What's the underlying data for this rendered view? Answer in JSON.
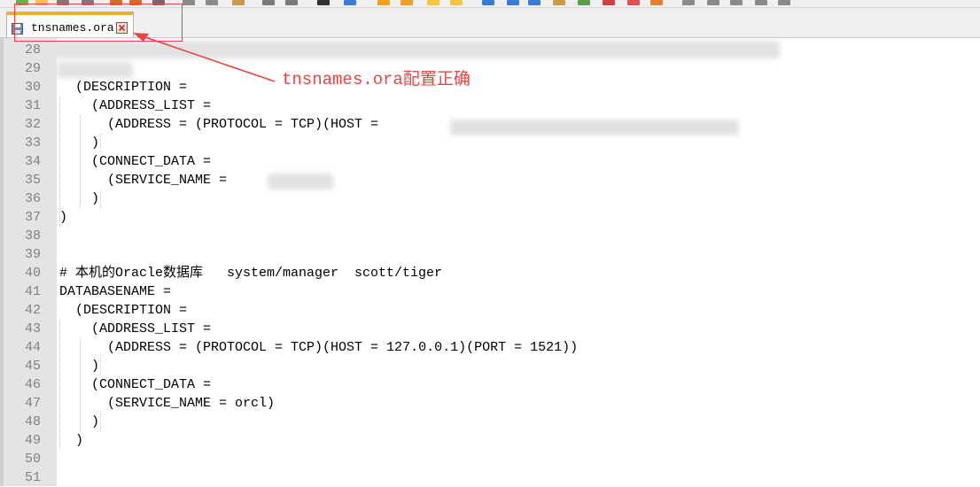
{
  "tab": {
    "title": "tnsnames.ora",
    "close_icon": "close-icon",
    "file_icon": "save-file-icon"
  },
  "annotation": {
    "text": "tnsnames.ora配置正确",
    "color": "#e84545"
  },
  "lines": [
    {
      "num": "28",
      "text": ""
    },
    {
      "num": "29",
      "text": ""
    },
    {
      "num": "30",
      "text": "  (DESCRIPTION ="
    },
    {
      "num": "31",
      "text": "    (ADDRESS_LIST ="
    },
    {
      "num": "32",
      "text": "      (ADDRESS = (PROTOCOL = TCP)(HOST ="
    },
    {
      "num": "33",
      "text": "    )"
    },
    {
      "num": "34",
      "text": "    (CONNECT_DATA ="
    },
    {
      "num": "35",
      "text": "      (SERVICE_NAME ="
    },
    {
      "num": "36",
      "text": "    )"
    },
    {
      "num": "37",
      "text": ")"
    },
    {
      "num": "38",
      "text": ""
    },
    {
      "num": "39",
      "text": ""
    },
    {
      "num": "40",
      "text": "# 本机的Oracle数据库   system/manager  scott/tiger"
    },
    {
      "num": "41",
      "text": "DATABASENAME ="
    },
    {
      "num": "42",
      "text": "  (DESCRIPTION ="
    },
    {
      "num": "43",
      "text": "    (ADDRESS_LIST ="
    },
    {
      "num": "44",
      "text": "      (ADDRESS = (PROTOCOL = TCP)(HOST = 127.0.0.1)(PORT = 1521))"
    },
    {
      "num": "45",
      "text": "    )"
    },
    {
      "num": "46",
      "text": "    (CONNECT_DATA ="
    },
    {
      "num": "47",
      "text": "      (SERVICE_NAME = orcl)"
    },
    {
      "num": "48",
      "text": "    )"
    },
    {
      "num": "49",
      "text": "  )"
    },
    {
      "num": "50",
      "text": ""
    },
    {
      "num": "51",
      "text": ""
    }
  ]
}
